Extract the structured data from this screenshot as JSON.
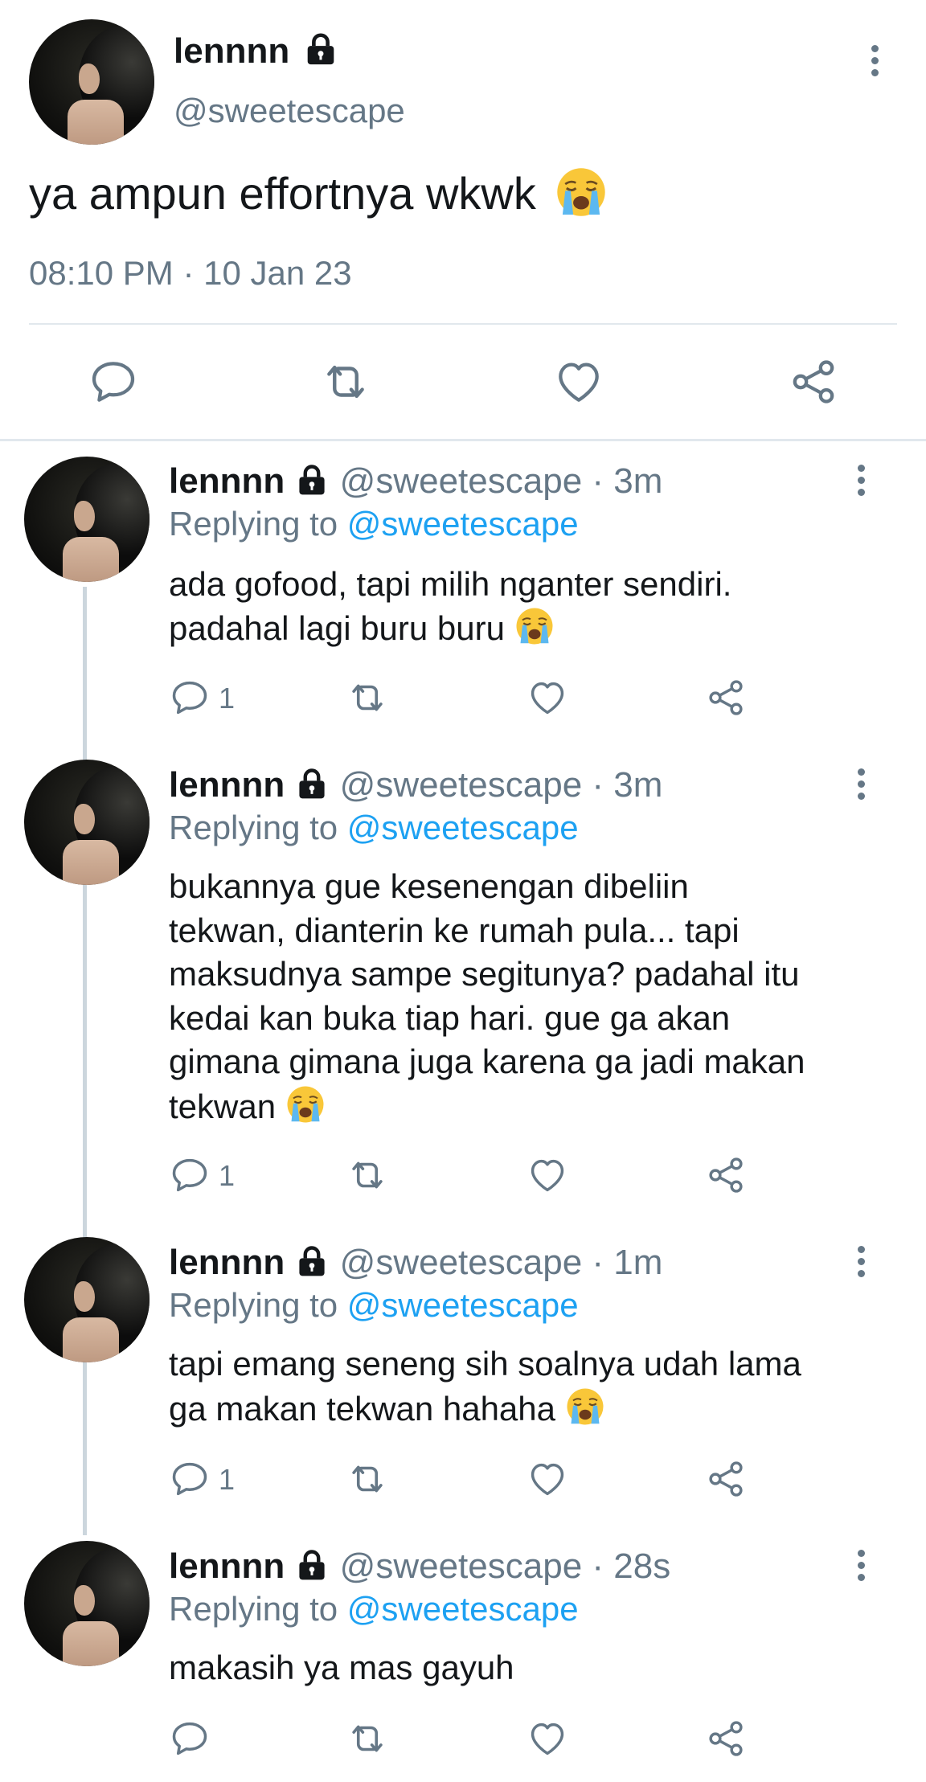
{
  "main_tweet": {
    "display_name": "lennnn",
    "handle": "@sweetescape",
    "text": "ya ampun effortnya wkwk",
    "timestamp": "08:10 PM · 10 Jan 23"
  },
  "replies": [
    {
      "display_name": "lennnn",
      "handle": "@sweetescape",
      "time": "· 3m",
      "replying_prefix": "Replying to",
      "replying_to": "@sweetescape",
      "lines": [
        "ada gofood, tapi milih nganter sendiri.",
        "padahal lagi buru buru"
      ],
      "reply_count": "1"
    },
    {
      "display_name": "lennnn",
      "handle": "@sweetescape",
      "time": "· 3m",
      "replying_prefix": "Replying to",
      "replying_to": "@sweetescape",
      "lines": [
        "bukannya gue kesenengan dibeliin",
        "tekwan, dianterin ke rumah pula... tapi",
        "maksudnya sampe segitunya? padahal itu",
        "kedai kan buka tiap hari. gue ga akan",
        "gimana gimana juga karena ga jadi makan",
        "tekwan"
      ],
      "reply_count": "1"
    },
    {
      "display_name": "lennnn",
      "handle": "@sweetescape",
      "time": "· 1m",
      "replying_prefix": "Replying to",
      "replying_to": "@sweetescape",
      "lines": [
        "tapi emang seneng sih soalnya udah lama",
        "ga makan tekwan hahaha"
      ],
      "reply_count": "1"
    },
    {
      "display_name": "lennnn",
      "handle": "@sweetescape",
      "time": "· 28s",
      "replying_prefix": "Replying to",
      "replying_to": "@sweetescape",
      "lines": [
        "makasih ya mas gayuh"
      ],
      "reply_count": ""
    }
  ],
  "colors": {
    "text": "#14171a",
    "secondary": "#657786",
    "link": "#1da1f2",
    "divider": "#e1e8ed",
    "thread_line": "#ccd6dd"
  },
  "icons": [
    "lock-icon",
    "more-icon",
    "reply-icon",
    "retweet-icon",
    "like-icon",
    "share-icon",
    "crying-face-emoji"
  ]
}
